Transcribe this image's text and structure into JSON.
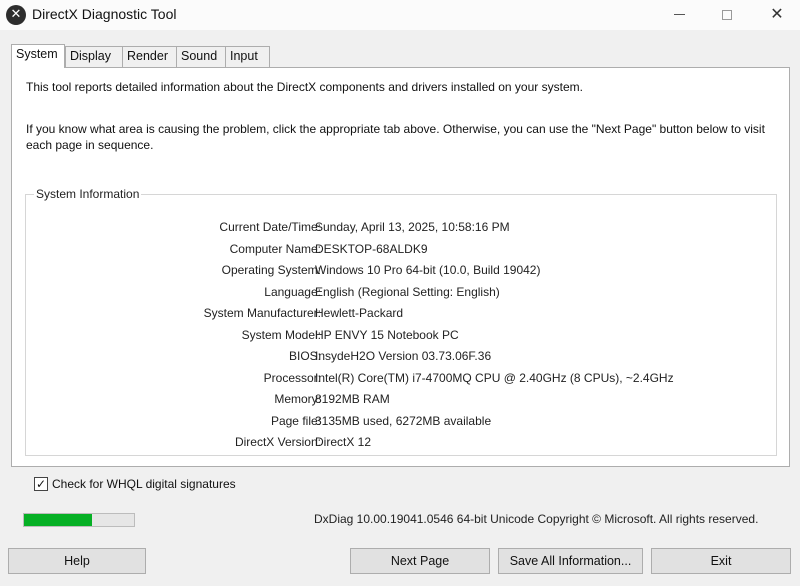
{
  "window": {
    "title": "DirectX Diagnostic Tool",
    "icon": "directx-icon",
    "controls": {
      "minimize": "minimize-icon",
      "maximize": "maximize-icon",
      "close": "✕"
    }
  },
  "tabs": [
    {
      "label": "System",
      "active": true
    },
    {
      "label": "Display"
    },
    {
      "label": "Render"
    },
    {
      "label": "Sound"
    },
    {
      "label": "Input"
    }
  ],
  "intro": {
    "line1": "This tool reports detailed information about the DirectX components and drivers installed on your system.",
    "line2": "If you know what area is causing the problem, click the appropriate tab above.  Otherwise, you can use the \"Next Page\" button below to visit each page in sequence."
  },
  "system_info": {
    "heading": "System Information",
    "rows": [
      {
        "label": "Current Date/Time:",
        "value": "Sunday, April 13, 2025, 10:58:16 PM"
      },
      {
        "label": "Computer Name:",
        "value": "DESKTOP-68ALDK9"
      },
      {
        "label": "Operating System:",
        "value": "Windows 10 Pro 64-bit (10.0, Build 19042)"
      },
      {
        "label": "Language:",
        "value": "English (Regional Setting: English)"
      },
      {
        "label": "System Manufacturer:",
        "value": "Hewlett-Packard"
      },
      {
        "label": "System Model:",
        "value": "HP ENVY 15 Notebook PC"
      },
      {
        "label": "BIOS:",
        "value": "InsydeH2O Version 03.73.06F.36"
      },
      {
        "label": "Processor:",
        "value": "Intel(R) Core(TM) i7-4700MQ CPU @ 2.40GHz (8 CPUs), ~2.4GHz"
      },
      {
        "label": "Memory:",
        "value": "8192MB RAM"
      },
      {
        "label": "Page file:",
        "value": "3135MB used, 6272MB available"
      },
      {
        "label": "DirectX Version:",
        "value": "DirectX 12"
      }
    ]
  },
  "whql": {
    "label": "Check for WHQL digital signatures",
    "checked": true
  },
  "progress": {
    "fraction": 0.62,
    "color": "#06b025"
  },
  "status_text": "DxDiag 10.00.19041.0546 64-bit Unicode  Copyright © Microsoft. All rights reserved.",
  "buttons": {
    "help": "Help",
    "next_page": "Next Page",
    "save_all": "Save All Information...",
    "exit": "Exit"
  }
}
